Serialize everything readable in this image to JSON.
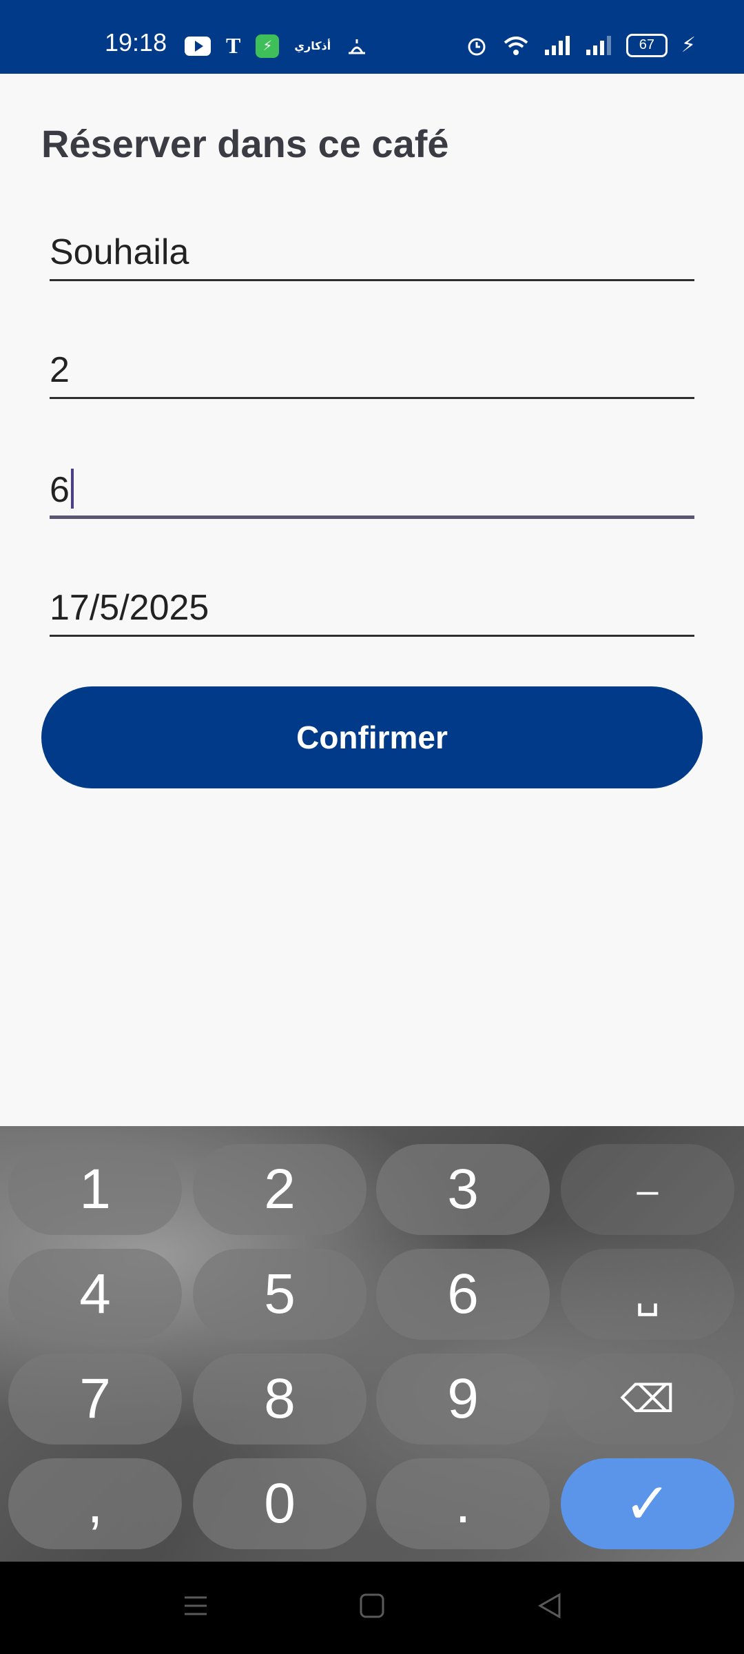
{
  "status_bar": {
    "time": "19:18",
    "arabic_app": "أذكاري",
    "battery": "67",
    "icons_left": [
      "youtube-icon",
      "t-app-icon",
      "shield-app-icon",
      "arabic-app-icon",
      "prayer-icon"
    ],
    "icons_right": [
      "alarm-icon",
      "wifi-icon",
      "signal-icon",
      "signal-icon",
      "battery-icon",
      "charging-icon"
    ]
  },
  "page": {
    "title": "Réserver dans ce café",
    "fields": [
      {
        "value": "Souhaila"
      },
      {
        "value": "2"
      },
      {
        "value": "6"
      },
      {
        "value": "17/5/2025"
      }
    ],
    "confirm_label": "Confirmer"
  },
  "keyboard": {
    "keys": [
      "1",
      "2",
      "3",
      "–",
      "4",
      "5",
      "6",
      "␣",
      "7",
      "8",
      "9",
      "⌫",
      ",",
      "0",
      ".",
      "✓"
    ]
  },
  "colors": {
    "primary": "#003a88",
    "keyboard_accent": "#5b95ea",
    "background": "#f8f8f8"
  }
}
